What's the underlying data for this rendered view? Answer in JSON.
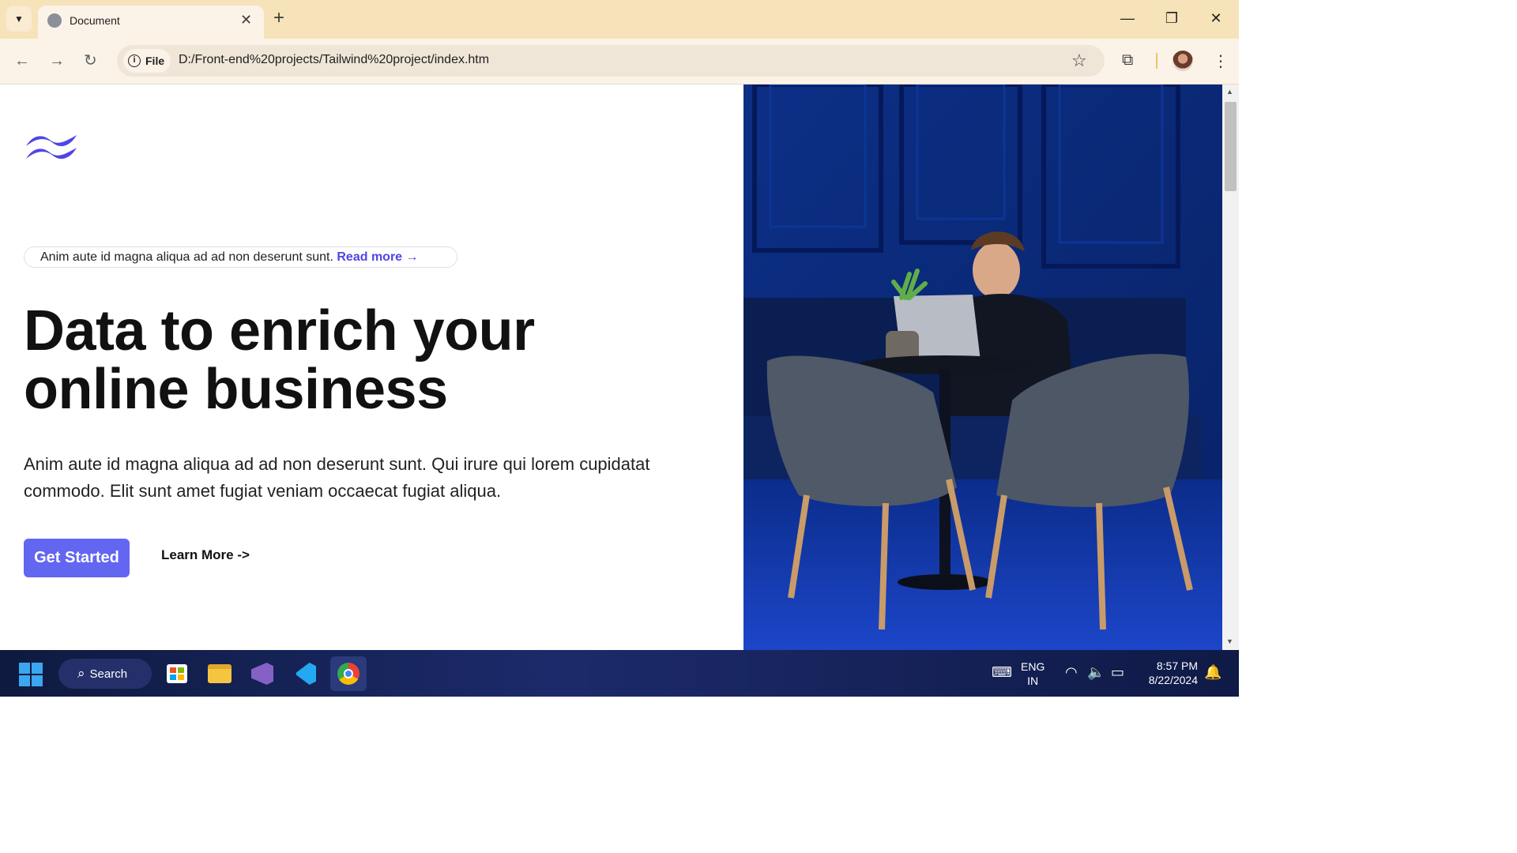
{
  "browser": {
    "tab_title": "Document",
    "url_chip": "File",
    "url": "D:/Front-end%20projects/Tailwind%20project/index.htm",
    "new_tab_symbol": "+",
    "close_symbol": "✕"
  },
  "page": {
    "notice_text": "Anim aute id magna aliqua ad ad non deserunt sunt.",
    "notice_link": "Read more →",
    "hero_line1": "Data to enrich your",
    "hero_line2": "online business",
    "hero_sub": "Anim aute id magna aliqua ad ad non deserunt sunt. Qui irure qui lorem cupidatat commodo. Elit sunt amet fugiat veniam occaecat fugiat aliqua.",
    "primary_button": "Get Started",
    "secondary_link": "Learn More ->",
    "accent_color": "#6366f1",
    "link_color": "#4f46e5"
  },
  "taskbar": {
    "search_label": "Search",
    "language_line1": "ENG",
    "language_line2": "IN",
    "time": "8:57 PM",
    "date": "8/22/2024"
  },
  "icons": [
    "chevron-down-icon",
    "globe-icon",
    "close-icon",
    "plus-icon",
    "minimize-icon",
    "restore-icon",
    "back-icon",
    "forward-icon",
    "reload-icon",
    "info-icon",
    "star-icon",
    "extensions-icon",
    "menu-icon",
    "tailwind-logo-icon",
    "windows-start-icon",
    "search-icon",
    "store-icon",
    "file-explorer-icon",
    "visual-studio-icon",
    "vscode-icon",
    "chrome-icon",
    "keyboard-icon",
    "wifi-icon",
    "volume-icon",
    "battery-icon",
    "bell-icon"
  ]
}
